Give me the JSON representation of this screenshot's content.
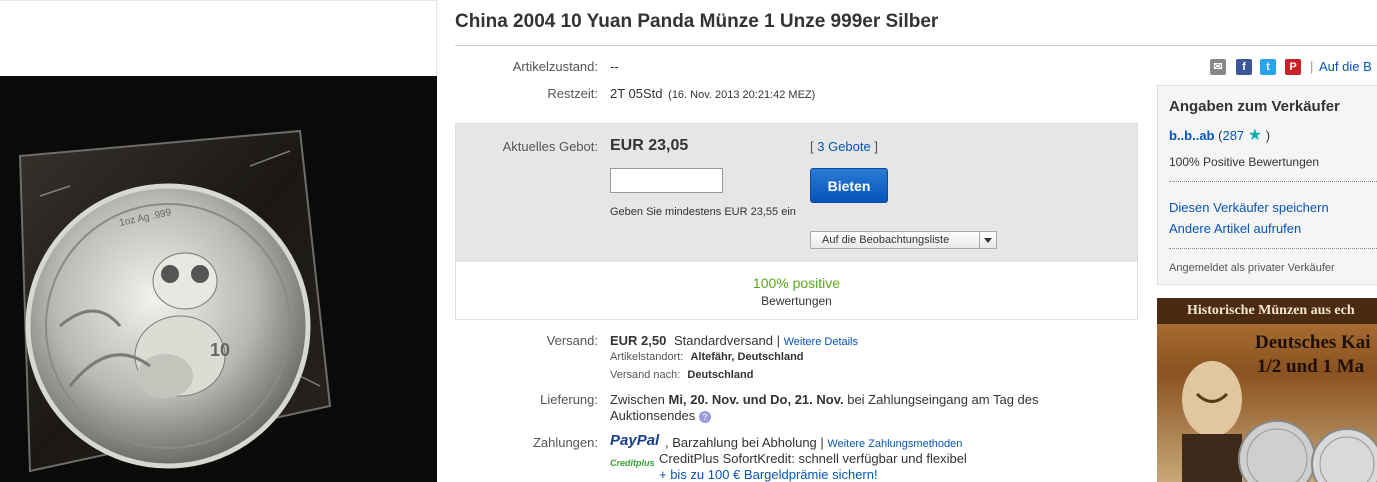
{
  "title": "China 2004 10 Yuan Panda Münze 1 Unze 999er Silber",
  "condition": {
    "label": "Artikelzustand:",
    "value": "--"
  },
  "time_left": {
    "label": "Restzeit:",
    "value": "2T 05Std",
    "end": "(16. Nov. 2013  20:21:42 MEZ)"
  },
  "bid": {
    "label": "Aktuelles Gebot:",
    "price": "EUR 23,05",
    "bids_open": "[",
    "bids_link": "3 Gebote",
    "bids_close": "]",
    "input_value": "",
    "button": "Bieten",
    "hint": "Geben Sie mindestens EUR 23,55 ein",
    "watch": "Auf die Beobachtungsliste"
  },
  "feedback": {
    "percent": "100% positive",
    "label": "Bewertungen"
  },
  "shipping": {
    "label": "Versand:",
    "price": "EUR 2,50",
    "type": "Standardversand |",
    "details_link": "Weitere Details",
    "location_label": "Artikelstandort:",
    "location": "Altefähr, Deutschland",
    "to_label": "Versand nach:",
    "to": "Deutschland"
  },
  "delivery": {
    "label": "Lieferung:",
    "prefix": "Zwischen",
    "dates": "Mi, 20. Nov. und Do, 21. Nov.",
    "suffix": "bei Zahlungseingang am Tag des",
    "line2": "Auktionsendes"
  },
  "payment": {
    "label": "Zahlungen:",
    "paypal": "PayPal",
    "cash": ",  Barzahlung bei Abholung  |",
    "more_link": "Weitere Zahlungsmethoden",
    "creditplus_logo": "Creditplus",
    "creditplus_text": "CreditPlus SofortKredit: schnell verfügbar und flexibel",
    "creditplus_link": "+ bis zu 100 € Bargeldprämie sichern!"
  },
  "share": {
    "link": "Auf die B",
    "sep": "|",
    "icons": [
      "mail-icon",
      "facebook-icon",
      "twitter-icon",
      "pinterest-icon"
    ]
  },
  "seller": {
    "heading": "Angaben zum Verkäufer",
    "name": "b..b..ab",
    "score_open": "(",
    "score": "287",
    "score_close": ")",
    "positive": "100% Positive Bewertungen",
    "save_link": "Diesen Verkäufer speichern",
    "other_link": "Andere Artikel aufrufen",
    "private": "Angemeldet als privater Verkäufer"
  },
  "ad": {
    "header": "Historische Münzen aus ech",
    "line1": "Deutsches Kai",
    "line2": "1/2 und 1 Ma"
  },
  "colors": {
    "link": "#0654ba",
    "positive": "#5ba71b",
    "bid_button": "#0654ba",
    "panel_gray": "#e6e6e6"
  }
}
